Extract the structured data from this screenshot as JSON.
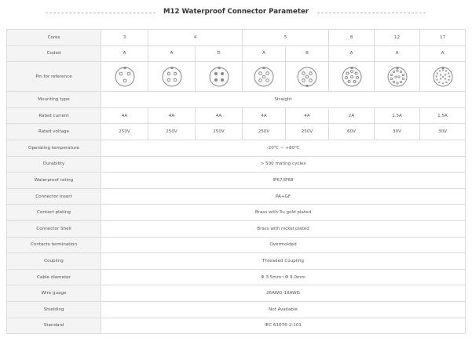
{
  "title": "M12 Waterproof Connector Parameter",
  "rows": {
    "cores": {
      "label": "Cores",
      "values": [
        "3",
        "4",
        "5",
        "8",
        "12",
        "17"
      ]
    },
    "coded": {
      "label": "Coded",
      "values": [
        "A",
        "A",
        "D",
        "A",
        "B",
        "A",
        "A",
        "A"
      ]
    },
    "pin": {
      "label": "Pin for reference",
      "pin_icons": [
        "m12-3pin-a-coded-icon",
        "m12-4pin-a-coded-icon",
        "m12-4pin-d-coded-icon",
        "m12-5pin-a-coded-icon",
        "m12-5pin-b-coded-icon",
        "m12-8pin-a-coded-icon",
        "m12-12pin-a-coded-icon",
        "m12-17pin-a-coded-icon"
      ]
    },
    "mounting": {
      "label": "Mounting type",
      "value": "Straight"
    },
    "current": {
      "label": "Rated current",
      "values": [
        "4A",
        "4A",
        "4A",
        "4A",
        "4A",
        "2A",
        "1.5A",
        "1.5A"
      ]
    },
    "voltage": {
      "label": "Rated voltage",
      "values": [
        "250V",
        "250V",
        "250V",
        "250V",
        "250V",
        "60V",
        "30V",
        "30V"
      ]
    },
    "temperature": {
      "label": "Operating temperature",
      "value": "-20℃ ~ +80℃"
    },
    "durability": {
      "label": "Durability",
      "value": "> 500 mating cycles"
    },
    "waterproof": {
      "label": "Waterproof rating",
      "value": "IP67/IP68"
    },
    "insert": {
      "label": "Connector insert",
      "value": "PA+GF"
    },
    "plating": {
      "label": "Contact plating",
      "value": "Brass with 3u gold plated"
    },
    "shell": {
      "label": "Connector Shell",
      "value": "Brass with nickel plated"
    },
    "termination": {
      "label": "Contacts termination",
      "value": "Overmolded"
    },
    "coupling": {
      "label": "Coupling",
      "value": "Threaded Coupling"
    },
    "diameter": {
      "label": "Cable diameter",
      "value": "Φ 3.5mm~Φ 9.0mm"
    },
    "gauge": {
      "label": "Wire guage",
      "value": "26AWG-18AWG"
    },
    "shielding": {
      "label": "Shielding",
      "value": "Not Available"
    },
    "standard": {
      "label": "Standard",
      "value": "IEC 61076-2-101"
    }
  }
}
